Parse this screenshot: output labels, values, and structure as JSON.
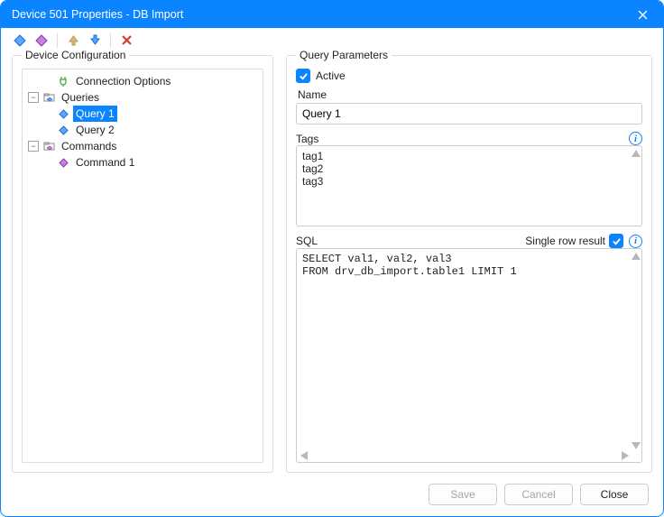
{
  "window": {
    "title": "Device 501 Properties - DB Import"
  },
  "toolbar": {
    "add_query": "Add Query",
    "add_command": "Add Command",
    "move_up": "Move Up",
    "move_down": "Move Down",
    "delete": "Delete"
  },
  "left": {
    "legend": "Device Configuration",
    "tree": {
      "connection_options": "Connection Options",
      "queries": "Queries",
      "query_items": [
        "Query 1",
        "Query 2"
      ],
      "commands": "Commands",
      "command_items": [
        "Command 1"
      ]
    },
    "selected": "Query 1"
  },
  "right": {
    "legend": "Query Parameters",
    "active_label": "Active",
    "active_checked": true,
    "name_label": "Name",
    "name_value": "Query 1",
    "tags_label": "Tags",
    "tags_lines": [
      "tag1",
      "tag2",
      "tag3"
    ],
    "sql_label": "SQL",
    "single_row_label": "Single row result",
    "single_row_checked": true,
    "sql_text": "SELECT val1, val2, val3\nFROM drv_db_import.table1 LIMIT 1"
  },
  "footer": {
    "save": "Save",
    "cancel": "Cancel",
    "close": "Close"
  }
}
